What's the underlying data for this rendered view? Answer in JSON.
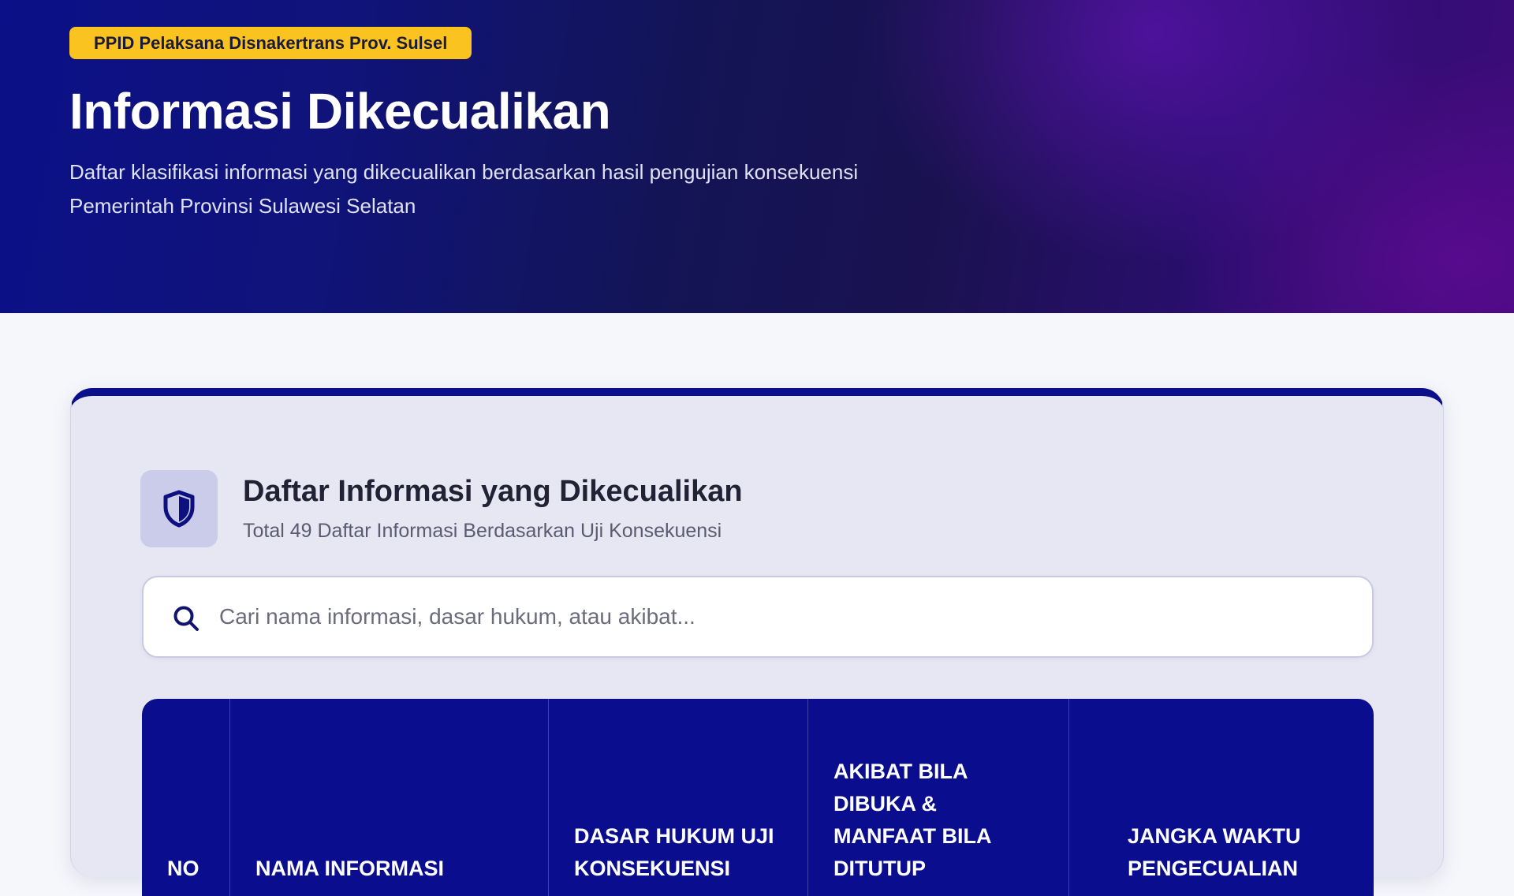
{
  "hero": {
    "badge": "PPID Pelaksana Disnakertrans Prov. Sulsel",
    "title": "Informasi Dikecualikan",
    "description_line1": "Daftar klasifikasi informasi yang dikecualikan berdasarkan hasil pengujian konsekuensi",
    "description_line2": "Pemerintah Provinsi Sulawesi Selatan"
  },
  "card": {
    "icon": "shield-icon",
    "title": "Daftar Informasi yang Dikecualikan",
    "subtitle": "Total 49 Daftar Informasi Berdasarkan Uji Konsekuensi"
  },
  "search": {
    "icon": "search-icon",
    "placeholder": "Cari nama informasi, dasar hukum, atau akibat...",
    "value": ""
  },
  "table": {
    "columns": [
      {
        "key": "no",
        "label": "No"
      },
      {
        "key": "nama",
        "label": "Nama Informasi"
      },
      {
        "key": "dasar",
        "label": "Dasar Hukum Uji Konsekuensi"
      },
      {
        "key": "akibat",
        "label": "Akibat Bila Dibuka & Manfaat Bila Ditutup"
      },
      {
        "key": "jangka",
        "label": "Jangka Waktu Pengecualian"
      }
    ]
  },
  "colors": {
    "accent_navy": "#0a0e8e",
    "badge_yellow": "#fbc31f",
    "card_bg": "#e7e7f3"
  }
}
